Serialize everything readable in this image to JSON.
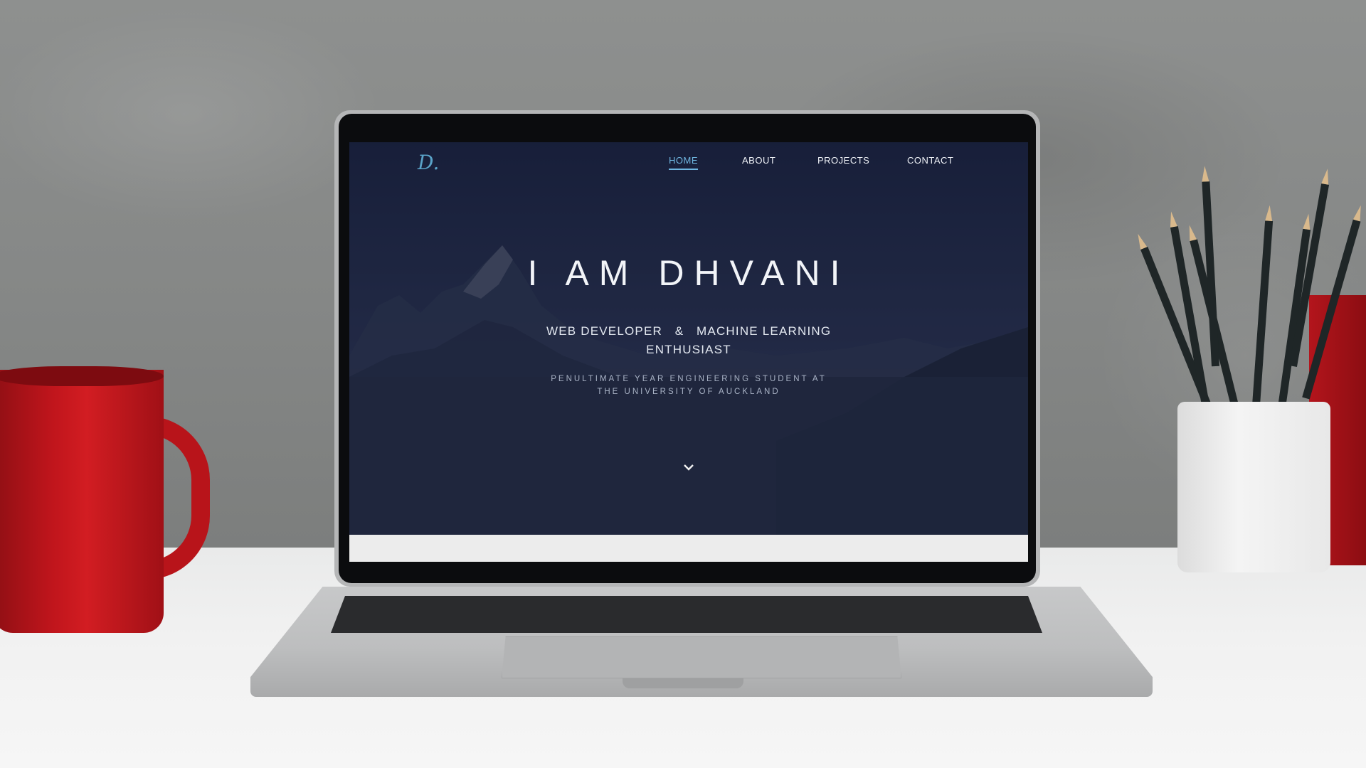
{
  "site": {
    "logo_text": "D.",
    "nav": [
      {
        "label": "HOME",
        "active": true
      },
      {
        "label": "ABOUT",
        "active": false
      },
      {
        "label": "PROJECTS",
        "active": false
      },
      {
        "label": "CONTACT",
        "active": false
      }
    ],
    "headline": "I AM DHVANI",
    "subline_1": "WEB DEVELOPER   &   MACHINE LEARNING",
    "subline_2": "ENTHUSIAST",
    "tagline_1": "PENULTIMATE YEAR ENGINEERING STUDENT AT",
    "tagline_2": "THE UNIVERSITY OF AUCKLAND",
    "scroll_icon": "chevron-down-icon"
  },
  "colors": {
    "accent": "#6fb6e0",
    "hero_bg": "#1d2740",
    "text": "#f2f4f8",
    "mug": "#c0151c"
  }
}
